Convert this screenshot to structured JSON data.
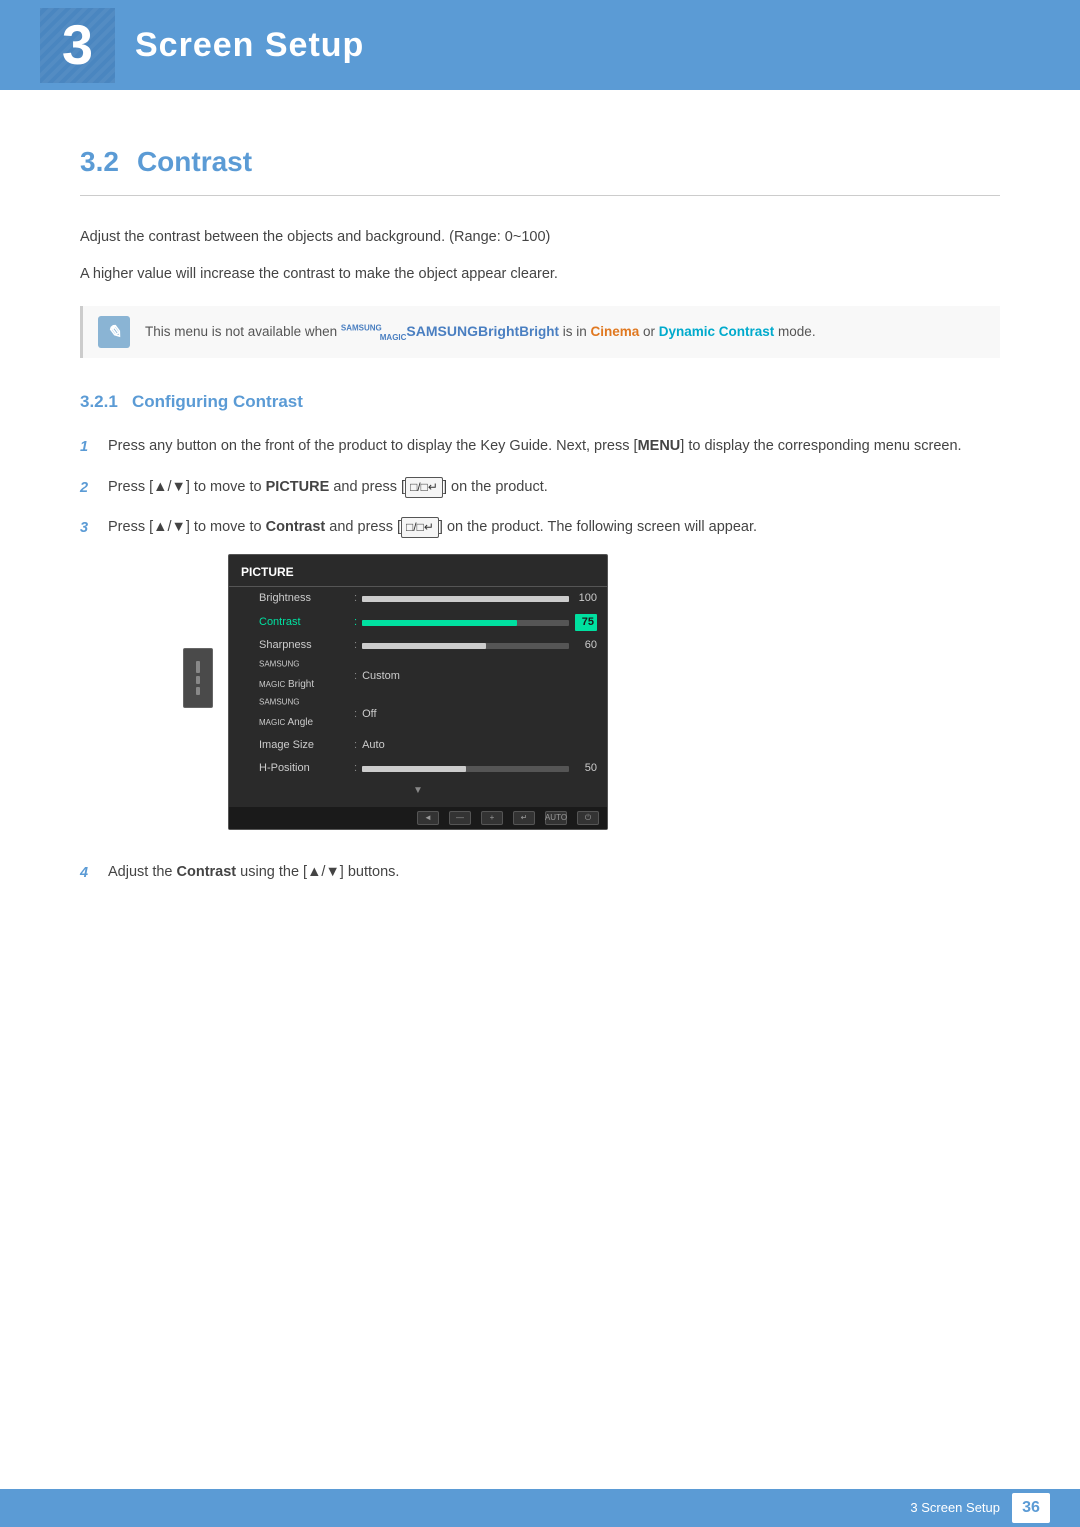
{
  "chapter": {
    "number": "3",
    "title": "Screen Setup"
  },
  "section": {
    "number": "3.2",
    "title": "Contrast"
  },
  "paragraphs": {
    "p1": "Adjust the contrast between the objects and background. (Range: 0~100)",
    "p2": "A higher value will increase the contrast to make the object appear clearer."
  },
  "note": {
    "text_before": "This menu is not available when ",
    "magic_bright": "SAMSUNGBright",
    "text_middle": " is in ",
    "cinema": "Cinema",
    "text_or": " or ",
    "dynamic_contrast": "Dynamic Contrast",
    "text_after": " mode."
  },
  "subsection": {
    "number": "3.2.1",
    "title": "Configuring Contrast"
  },
  "steps": [
    {
      "num": "1",
      "text_before": "Press any button on the front of the product to display the Key Guide. Next, press [",
      "key": "MENU",
      "text_after": "] to display the corresponding menu screen."
    },
    {
      "num": "2",
      "text_before": "Press [▲/▼] to move to ",
      "bold1": "PICTURE",
      "text_middle": " and press [",
      "key": "□/□+",
      "text_after": "] on the product."
    },
    {
      "num": "3",
      "text_before": "Press [▲/▼] to move to ",
      "bold1": "Contrast",
      "text_middle": " and press [",
      "key": "□/□+",
      "text_after": "] on the product. The following screen will appear."
    },
    {
      "num": "4",
      "text_before": "Adjust the ",
      "bold1": "Contrast",
      "text_after": " using the [▲/▼] buttons."
    }
  ],
  "osd": {
    "title": "PICTURE",
    "items": [
      {
        "name": "Brightness",
        "type": "bar",
        "value": 100,
        "fill_pct": 100,
        "selected": false
      },
      {
        "name": "Contrast",
        "type": "bar",
        "value": 75,
        "fill_pct": 75,
        "selected": true
      },
      {
        "name": "Sharpness",
        "type": "bar",
        "value": 60,
        "fill_pct": 60,
        "selected": false
      },
      {
        "name": "SAMSUNG MAGIC Bright",
        "type": "text",
        "text_value": "Custom",
        "selected": false
      },
      {
        "name": "SAMSUNG MAGIC Angle",
        "type": "text",
        "text_value": "Off",
        "selected": false
      },
      {
        "name": "Image Size",
        "type": "text",
        "text_value": "Auto",
        "selected": false
      },
      {
        "name": "H-Position",
        "type": "bar",
        "value": 50,
        "fill_pct": 50,
        "selected": false
      }
    ]
  },
  "footer": {
    "text": "3 Screen Setup",
    "page": "36"
  }
}
